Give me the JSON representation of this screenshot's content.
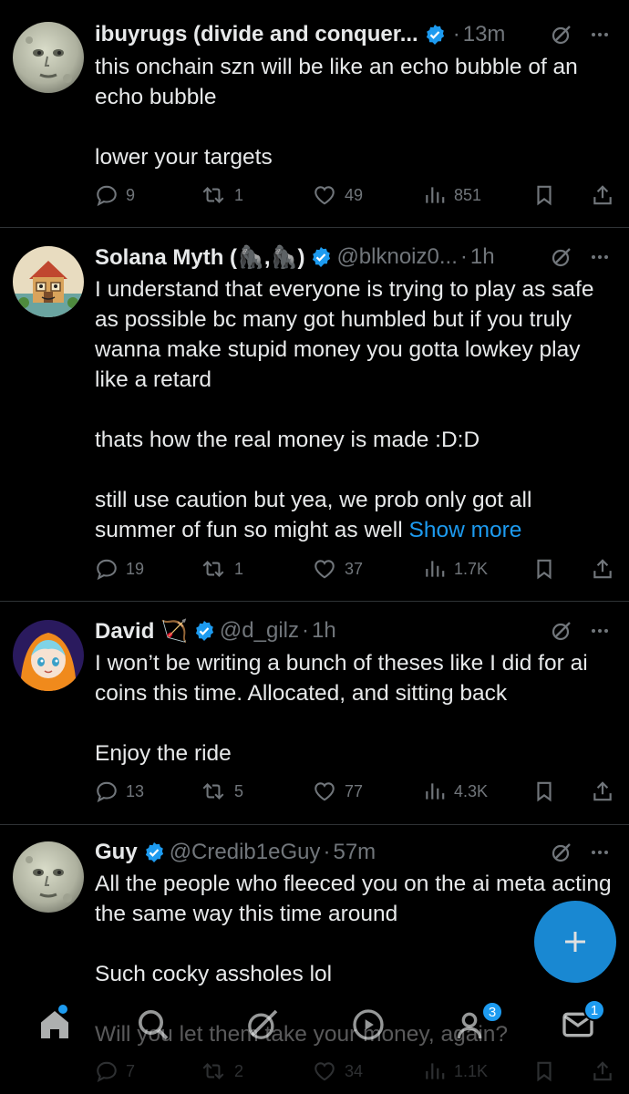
{
  "tweets": [
    {
      "name": "ibuyrugs (divide and conquer...",
      "handle": "",
      "time": "13m",
      "paragraphs": [
        "this onchain szn will be like an echo bubble of an echo bubble",
        "lower your targets"
      ],
      "show_more": "",
      "replies": "9",
      "retweets": "1",
      "likes": "49",
      "views": "851",
      "avatar": "moon-face"
    },
    {
      "name": "Solana Myth (🦍,🦍)",
      "handle": "@blknoiz0...",
      "time": "1h",
      "paragraphs": [
        "I understand that everyone is trying to play as safe as possible bc many got humbled but if you truly wanna make stupid money you gotta lowkey play like a retard",
        "thats how the real money is made :D:D",
        "still use caution but yea, we prob only got all summer of fun so might as well"
      ],
      "show_more": "Show more",
      "replies": "19",
      "retweets": "1",
      "likes": "37",
      "views": "1.7K",
      "avatar": "cartoon-house"
    },
    {
      "name": "David 🏹",
      "handle": "@d_gilz",
      "time": "1h",
      "paragraphs": [
        "I won’t be writing a bunch of theses like I did for ai coins this time. Allocated, and sitting back",
        "Enjoy the ride"
      ],
      "show_more": "",
      "replies": "13",
      "retweets": "5",
      "likes": "77",
      "views": "4.3K",
      "avatar": "anime-orange-hood"
    },
    {
      "name": "Guy",
      "handle": "@Credib1eGuy",
      "time": "57m",
      "paragraphs": [
        "All the people who fleeced you on the ai meta acting the same way this time around",
        "Such cocky assholes lol",
        "Will you let them take your money, again?"
      ],
      "show_more": "",
      "replies": "7",
      "retweets": "2",
      "likes": "34",
      "views": "1.1K",
      "avatar": "moon-face"
    }
  ],
  "separator": "·",
  "fab_label": "+",
  "nav": {
    "communities_badge": "3",
    "messages_badge": "1"
  },
  "colors": {
    "background": "#000000",
    "text": "#e7e9ea",
    "muted": "#71767b",
    "accent": "#1d9bf0"
  }
}
